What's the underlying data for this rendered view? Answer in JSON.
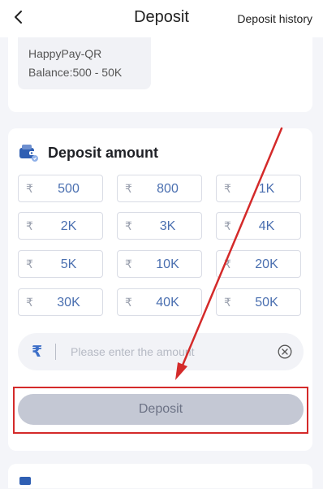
{
  "header": {
    "title": "Deposit",
    "history_label": "Deposit history",
    "back_icon": "chevron-left-icon"
  },
  "channel": {
    "name": "HappyPay-QR",
    "balance": "Balance:500 - 50K"
  },
  "amount_section": {
    "title": "Deposit amount",
    "icon": "wallet-icon",
    "currency_symbol": "₹",
    "options": [
      {
        "label": "500"
      },
      {
        "label": "800"
      },
      {
        "label": "1K"
      },
      {
        "label": "2K"
      },
      {
        "label": "3K"
      },
      {
        "label": "4K"
      },
      {
        "label": "5K"
      },
      {
        "label": "10K"
      },
      {
        "label": "20K"
      },
      {
        "label": "30K"
      },
      {
        "label": "40K"
      },
      {
        "label": "50K"
      }
    ],
    "input": {
      "value": "",
      "placeholder": "Please enter the amount"
    },
    "deposit_button_label": "Deposit"
  },
  "colors": {
    "accent_blue": "#3d6fc8",
    "annotation_red": "#d42a2a",
    "disabled_button": "#c4c8d4"
  }
}
